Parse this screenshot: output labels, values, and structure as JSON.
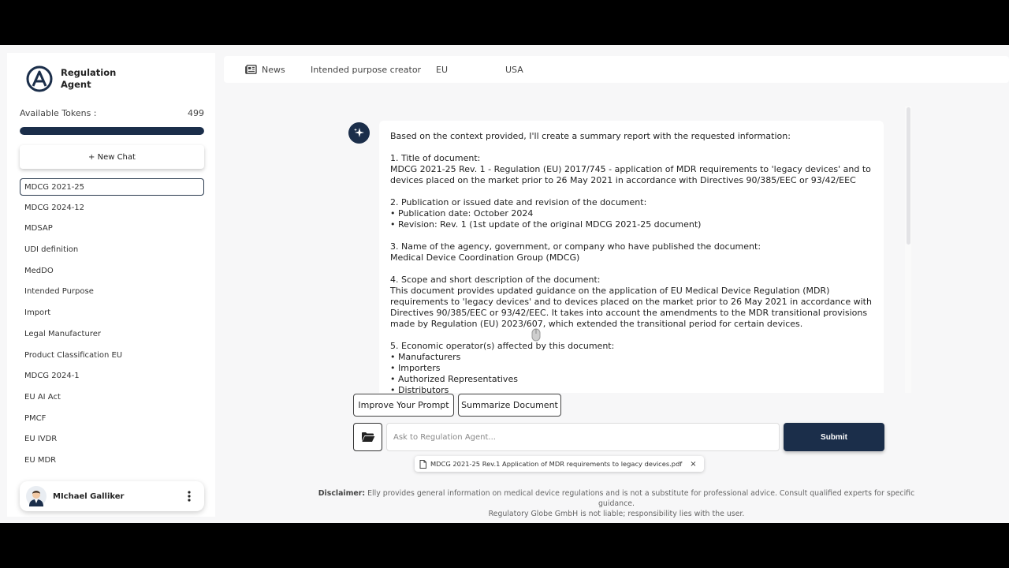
{
  "sidebar": {
    "brand": "Regulation Agent",
    "tokens_label": "Available Tokens :",
    "tokens_value": "499",
    "token_fill_fraction": 1.0,
    "new_chat_label": "+ New Chat",
    "chats": [
      {
        "label": "MDCG 2021-25",
        "active": true
      },
      {
        "label": "MDCG 2024-12"
      },
      {
        "label": "MDSAP"
      },
      {
        "label": "UDI definition"
      },
      {
        "label": "MedDO"
      },
      {
        "label": "Intended Purpose"
      },
      {
        "label": "Import"
      },
      {
        "label": "Legal Manufacturer"
      },
      {
        "label": "Product Classification EU"
      },
      {
        "label": "MDCG 2024-1"
      },
      {
        "label": "EU AI Act"
      },
      {
        "label": "PMCF"
      },
      {
        "label": "EU IVDR"
      },
      {
        "label": "EU MDR"
      }
    ],
    "user_name": "MIchael Galliker"
  },
  "topnav": {
    "news": "News",
    "intended_purpose": "Intended purpose creator",
    "eu": "EU",
    "usa": "USA"
  },
  "message": {
    "intro": "Based on the context provided, I'll create a summary report with the requested information:",
    "s1_title": "1. Title of document:",
    "s1_body": "MDCG 2021-25 Rev. 1 - Regulation (EU) 2017/745 - application of MDR requirements to 'legacy devices' and to devices placed on the market prior to 26 May 2021 in accordance with Directives 90/385/EEC or 93/42/EEC",
    "s2_title": "2. Publication or issued date and revision of the document:",
    "s2_b1": "• Publication date: October 2024",
    "s2_b2": "• Revision: Rev. 1 (1st update of the original MDCG 2021-25 document)",
    "s3_title": "3. Name of the agency, government, or company who have published the document:",
    "s3_body": "Medical Device Coordination Group (MDCG)",
    "s4_title": "4. Scope and short description of the document:",
    "s4_body": "This document provides updated guidance on the application of EU Medical Device Regulation (MDR) requirements to 'legacy devices' and to devices placed on the market prior to 26 May 2021 in accordance with Directives 90/385/EEC or 93/42/EEC. It takes into account the amendments to the MDR transitional provisions made by Regulation (EU) 2023/607, which extended the transitional period for certain devices.",
    "s5_title": "5. Economic operator(s) affected by this document:",
    "s5_b1": "• Manufacturers",
    "s5_b2": "• Importers",
    "s5_b3": "• Authorized Representatives",
    "s5_b4": "• Distributors"
  },
  "actions": {
    "improve": "Improve Your Prompt",
    "summarize": "Summarize Document",
    "input_placeholder": "Ask to Regulation Agent...",
    "input_value": "",
    "submit": "Submit",
    "attachment": "MDCG 2021-25 Rev.1 Application of MDR requirements to legacy devices.pdf",
    "remove": "×"
  },
  "disclaimer": {
    "label": "Disclaimer:",
    "text": " Elly provides general information on medical device regulations and is not a substitute for professional advice. Consult qualified experts for specific guidance.",
    "line2": "Regulatory Globe GmbH is not liable; responsibility lies with the user."
  },
  "colors": {
    "accent": "#1b2e4a",
    "background": "#f7f7f8"
  },
  "icons": [
    "brand-logo-icon",
    "news-icon",
    "sparkle-icon",
    "folder-icon",
    "file-icon",
    "kebab-icon",
    "avatar"
  ]
}
